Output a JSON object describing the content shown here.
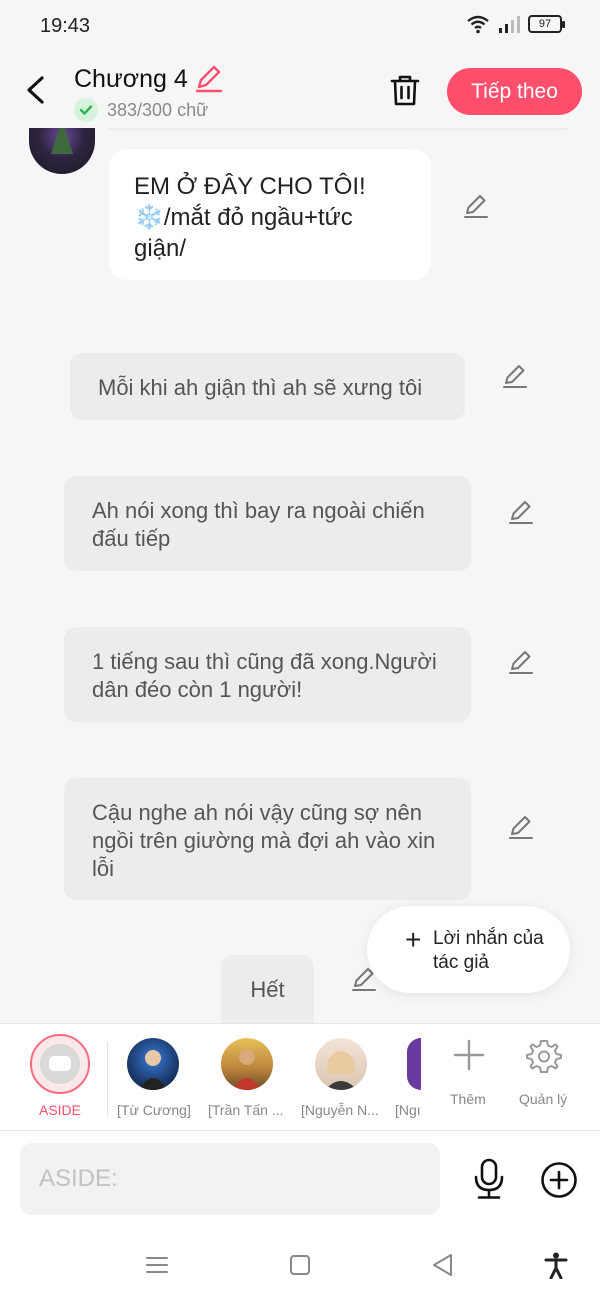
{
  "status_bar": {
    "time": "19:43",
    "battery": "97"
  },
  "header": {
    "chapter_title": "Chương 4",
    "word_count": "383/300 chữ",
    "next_label": "Tiếp theo",
    "accent_color": "#ff4f6d"
  },
  "messages": [
    {
      "text": "EM Ở ĐÂY CHO TÔI! ❄️/mắt đỏ ngầu+tức giận/",
      "style": "character"
    },
    {
      "text": "Mỗi khi ah giận thì ah sẽ xưng tôi",
      "style": "aside"
    },
    {
      "text": "Ah nói xong thì bay ra ngoài chiến đấu tiếp",
      "style": "aside"
    },
    {
      "text": "1 tiếng sau thì cũng đã xong.Người dân đéo còn 1 người!",
      "style": "aside"
    },
    {
      "text": "Cậu nghe ah nói vậy cũng sợ nên ngồi trên giường mà đợi ah vào xin lỗi",
      "style": "aside"
    },
    {
      "text": "Hết",
      "style": "aside"
    }
  ],
  "author_note": {
    "label": "Lời nhắn của tác giả"
  },
  "characters": {
    "aside_label": "ASIDE",
    "list": [
      {
        "name": "[Từ Cương]"
      },
      {
        "name": "[Trần Tấn ..."
      },
      {
        "name": "[Nguyễn N..."
      },
      {
        "name": "[Ngı"
      }
    ],
    "add_label": "Thêm",
    "manage_label": "Quản lý"
  },
  "composer": {
    "placeholder": "ASIDE:"
  }
}
